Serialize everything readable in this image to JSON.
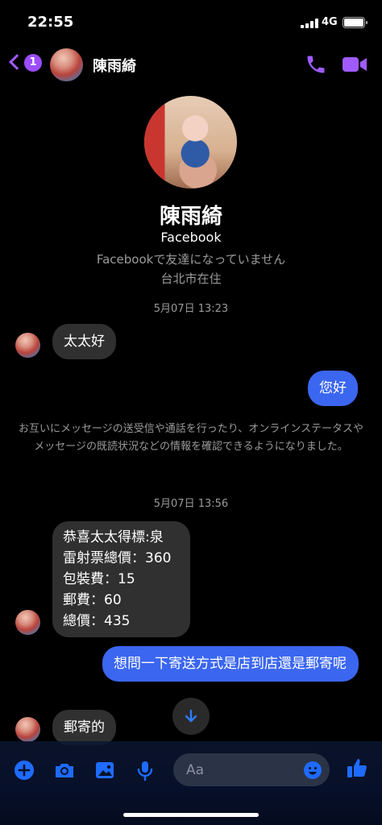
{
  "status_bar": {
    "time": "22:55",
    "network": "4G"
  },
  "header": {
    "back_badge": "1",
    "contact_name": "陳雨綺"
  },
  "profile": {
    "name": "陳雨綺",
    "subtitle": "Facebook",
    "friend_status": "Facebookで友達になっていません",
    "location": "台北市在住"
  },
  "conversation": {
    "timestamp_1": "5月07日 13:23",
    "msg_1": "太太好",
    "msg_2": "您好",
    "system_notice": "お互いにメッセージの送受信や通話を行ったり、オンラインステータスやメッセージの既読状況などの情報を確認できるようになりました。",
    "timestamp_2": "5月07日 13:56",
    "msg_3_lines": [
      "恭喜太太得標:泉",
      "雷射票總價：360",
      "包裝費：15",
      "郵費：60",
      "總價：435"
    ],
    "msg_4": "想問一下寄送方式是店到店還是郵寄呢",
    "msg_5": "郵寄的"
  },
  "composer": {
    "placeholder": "Aa"
  },
  "colors": {
    "accent_purple": "#9b4dff",
    "outgoing_bubble": "#3b66f0",
    "incoming_bubble": "#303030",
    "composer_blue": "#1e6bff"
  },
  "icons": [
    "back-chevron-icon",
    "phone-icon",
    "video-camera-icon",
    "arrow-down-icon",
    "plus-icon",
    "camera-icon",
    "image-icon",
    "microphone-icon",
    "emoji-icon",
    "thumbs-up-icon"
  ]
}
